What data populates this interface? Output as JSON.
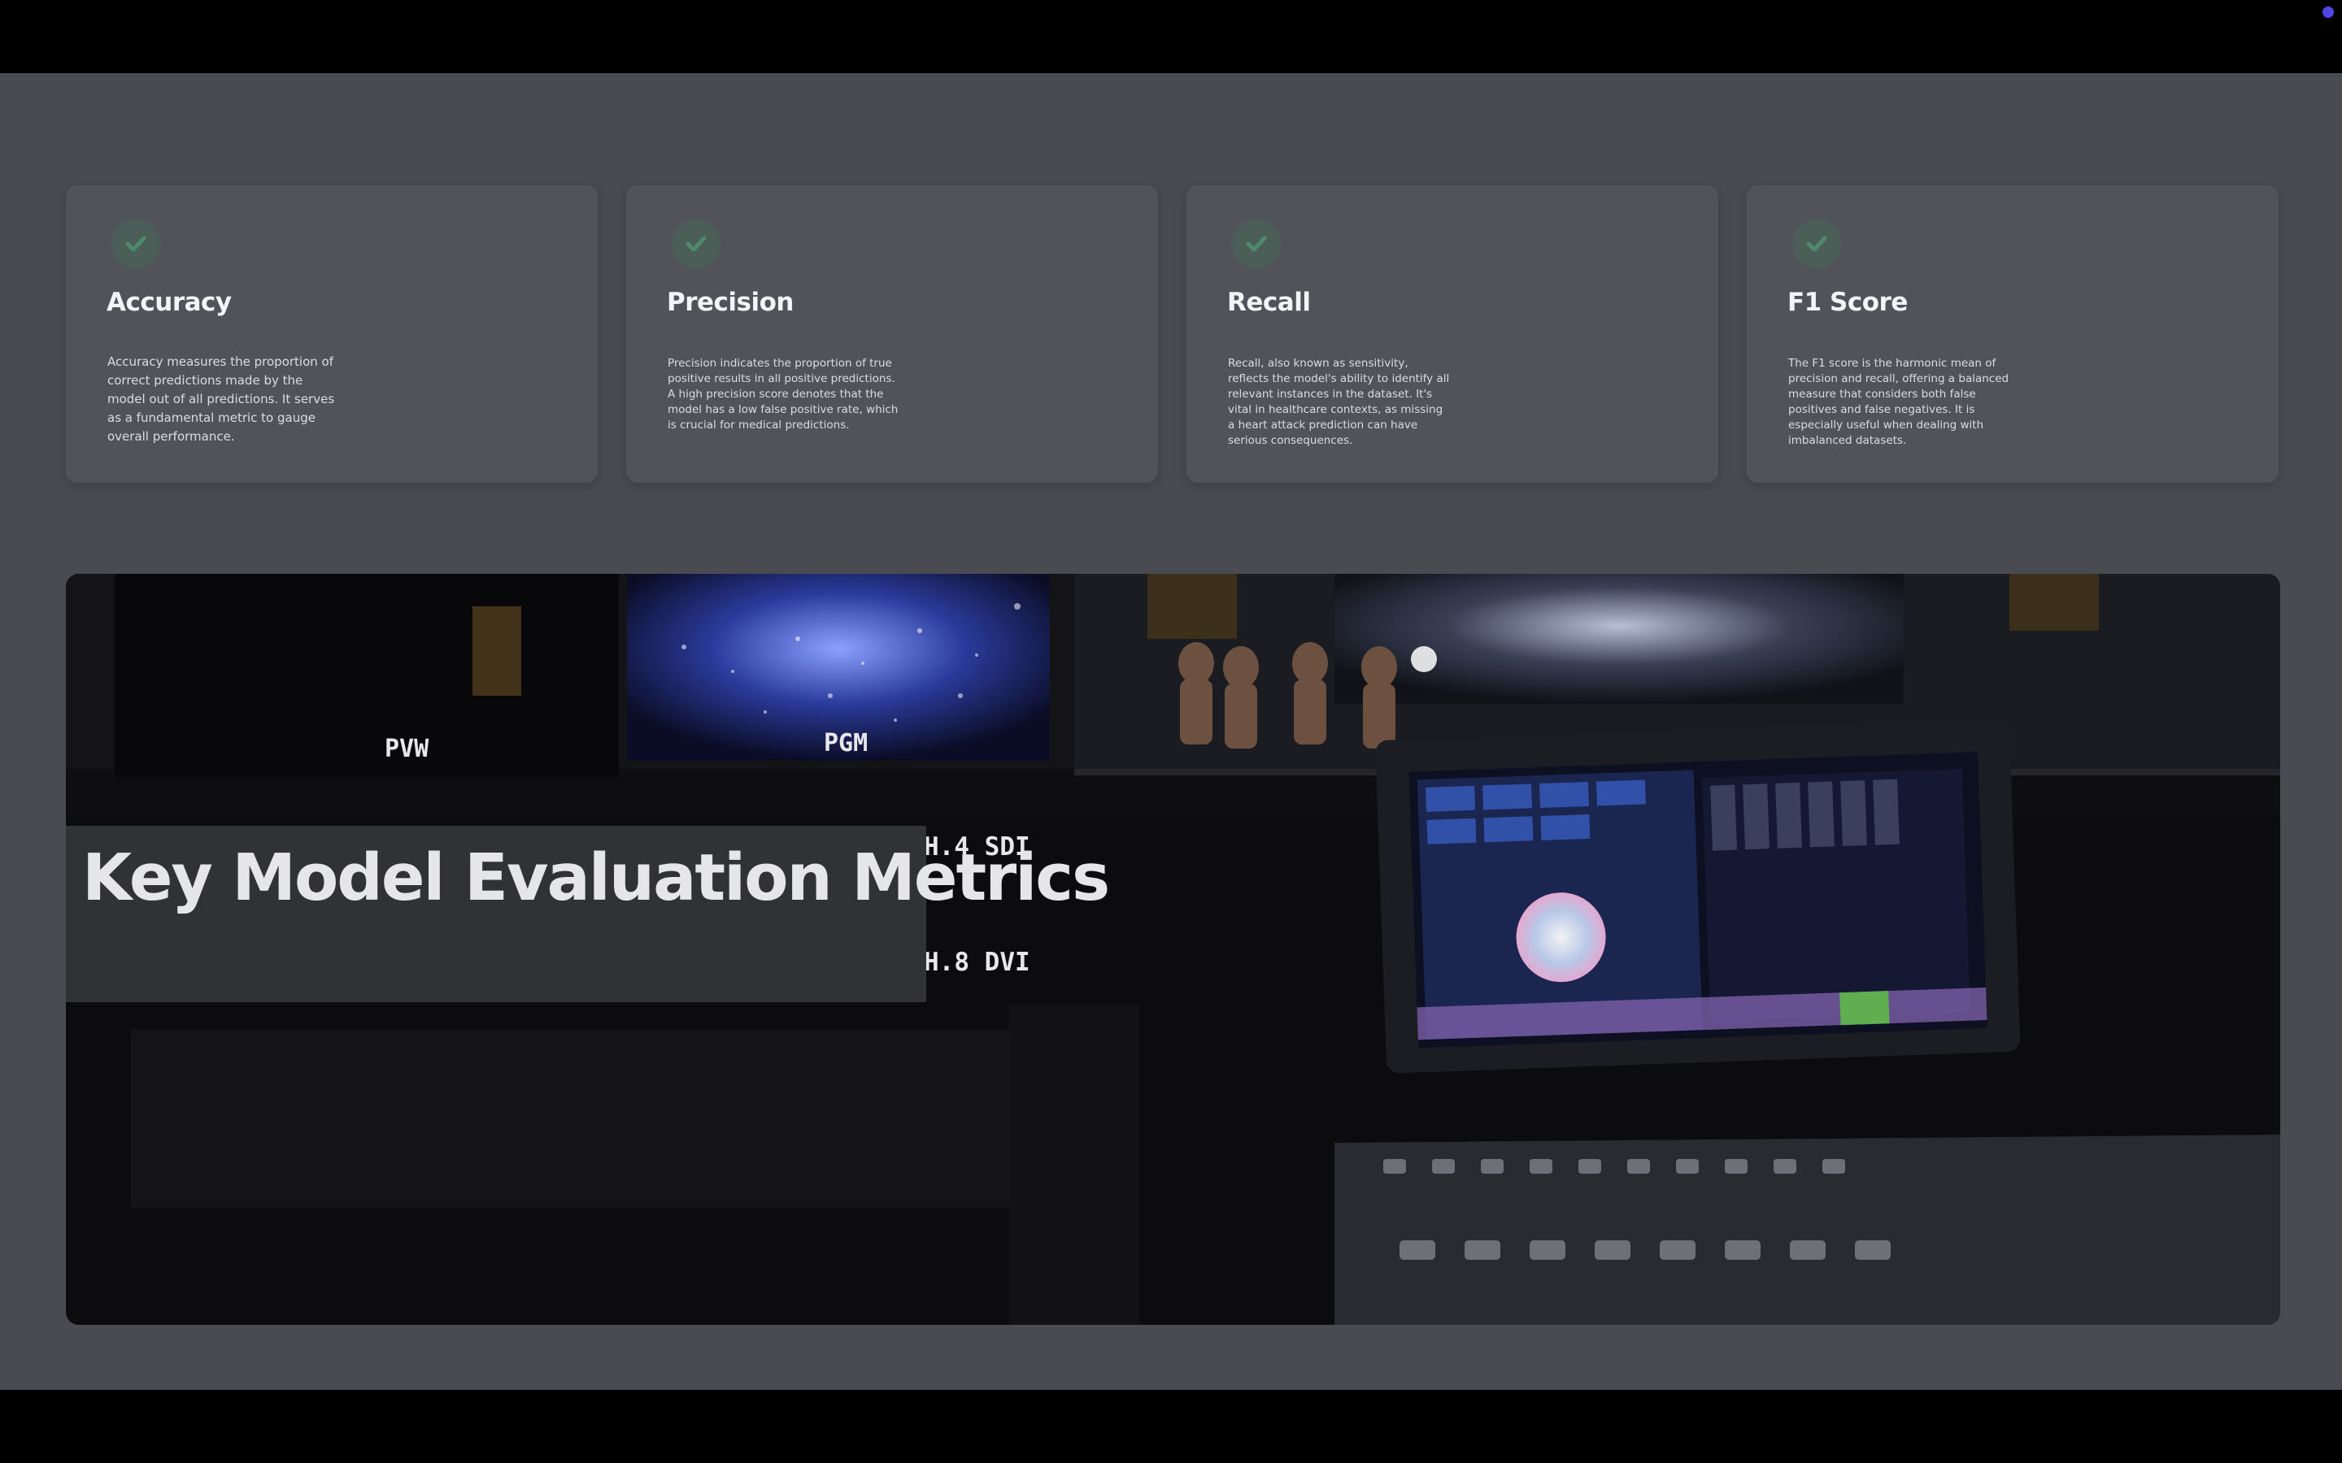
{
  "title": "Key Model Evaluation Metrics",
  "cards": [
    {
      "icon": "check-circle-icon",
      "title": "Accuracy",
      "description": "Accuracy measures the proportion of correct predictions made by the model out of all predictions. It serves as a fundamental metric to gauge overall performance."
    },
    {
      "icon": "check-circle-icon",
      "title": "Precision",
      "description": "Precision indicates the proportion of true positive results in all positive predictions. A high precision score denotes that the model has a low false positive rate, which is crucial for medical predictions."
    },
    {
      "icon": "check-circle-icon",
      "title": "Recall",
      "description": "Recall, also known as sensitivity, reflects the model's ability to identify all relevant instances in the dataset. It's vital in healthcare contexts, as missing a heart attack prediction can have serious consequences."
    },
    {
      "icon": "check-circle-icon",
      "title": "F1 Score",
      "description": "The F1 score is the harmonic mean of precision and recall, offering a balanced measure that considers both false positives and false negatives. It is especially useful when dealing with imbalanced datasets."
    }
  ],
  "photo": {
    "monitor_labels": [
      "PVW",
      "PGM",
      "H.4 SDI",
      "H.8 DVI"
    ]
  },
  "colors": {
    "slide_background": "#4a4b51",
    "card_background": "#525359",
    "check_icon": "#4e8a6a",
    "title_box": "#313235",
    "indicator_dot": "#4f46e5"
  }
}
